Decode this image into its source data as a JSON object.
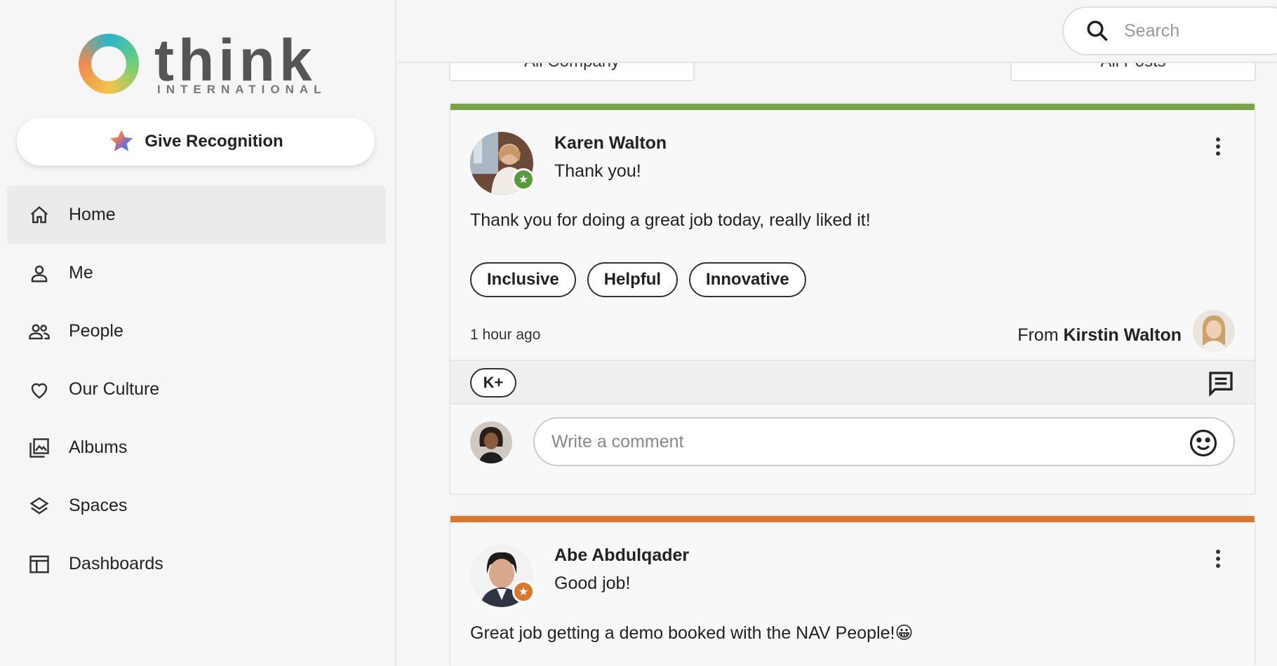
{
  "brand": {
    "name": "think",
    "subtitle": "INTERNATIONAL"
  },
  "sidebar": {
    "give_recognition_label": "Give Recognition",
    "items": [
      {
        "label": "Home",
        "icon": "home-icon",
        "active": true
      },
      {
        "label": "Me",
        "icon": "person-icon"
      },
      {
        "label": "People",
        "icon": "people-icon"
      },
      {
        "label": "Our Culture",
        "icon": "heart-icon"
      },
      {
        "label": "Albums",
        "icon": "albums-icon"
      },
      {
        "label": "Spaces",
        "icon": "layers-icon"
      },
      {
        "label": "Dashboards",
        "icon": "dashboard-icon"
      }
    ]
  },
  "search": {
    "placeholder": "Search"
  },
  "filters": {
    "scope": "All Company",
    "type": "All Posts"
  },
  "posts": [
    {
      "author": "Karen Walton",
      "subtitle": "Thank you!",
      "message": "Thank you for doing a great job today, really liked it!",
      "tags": [
        "Inclusive",
        "Helpful",
        "Innovative"
      ],
      "time": "1 hour ago",
      "from_prefix": "From",
      "from_name": "Kirstin Walton",
      "accent_color": "#7aa44a",
      "reaction_label": "K+",
      "comment_placeholder": "Write a comment"
    },
    {
      "author": "Abe Abdulqader",
      "subtitle": "Good job!",
      "message": "Great job getting a demo booked with the NAV People!😀",
      "accent_color": "#d9772f"
    }
  ]
}
